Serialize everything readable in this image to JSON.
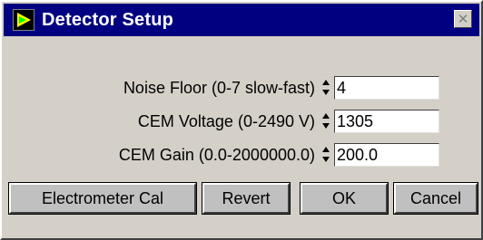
{
  "window": {
    "title": "Detector Setup",
    "close_glyph": "✕",
    "icon": "detector-app-icon"
  },
  "fields": [
    {
      "label": "Noise Floor (0-7 slow-fast)",
      "value": "4"
    },
    {
      "label": "CEM Voltage (0-2490 V)",
      "value": "1305"
    },
    {
      "label": "CEM Gain (0.0-2000000.0)",
      "value": "200.0"
    }
  ],
  "buttons": {
    "electrometer_cal": "Electrometer Cal",
    "revert": "Revert",
    "ok": "OK",
    "cancel": "Cancel"
  },
  "colors": {
    "titlebar": "#000080",
    "face": "#d4d0c8"
  }
}
